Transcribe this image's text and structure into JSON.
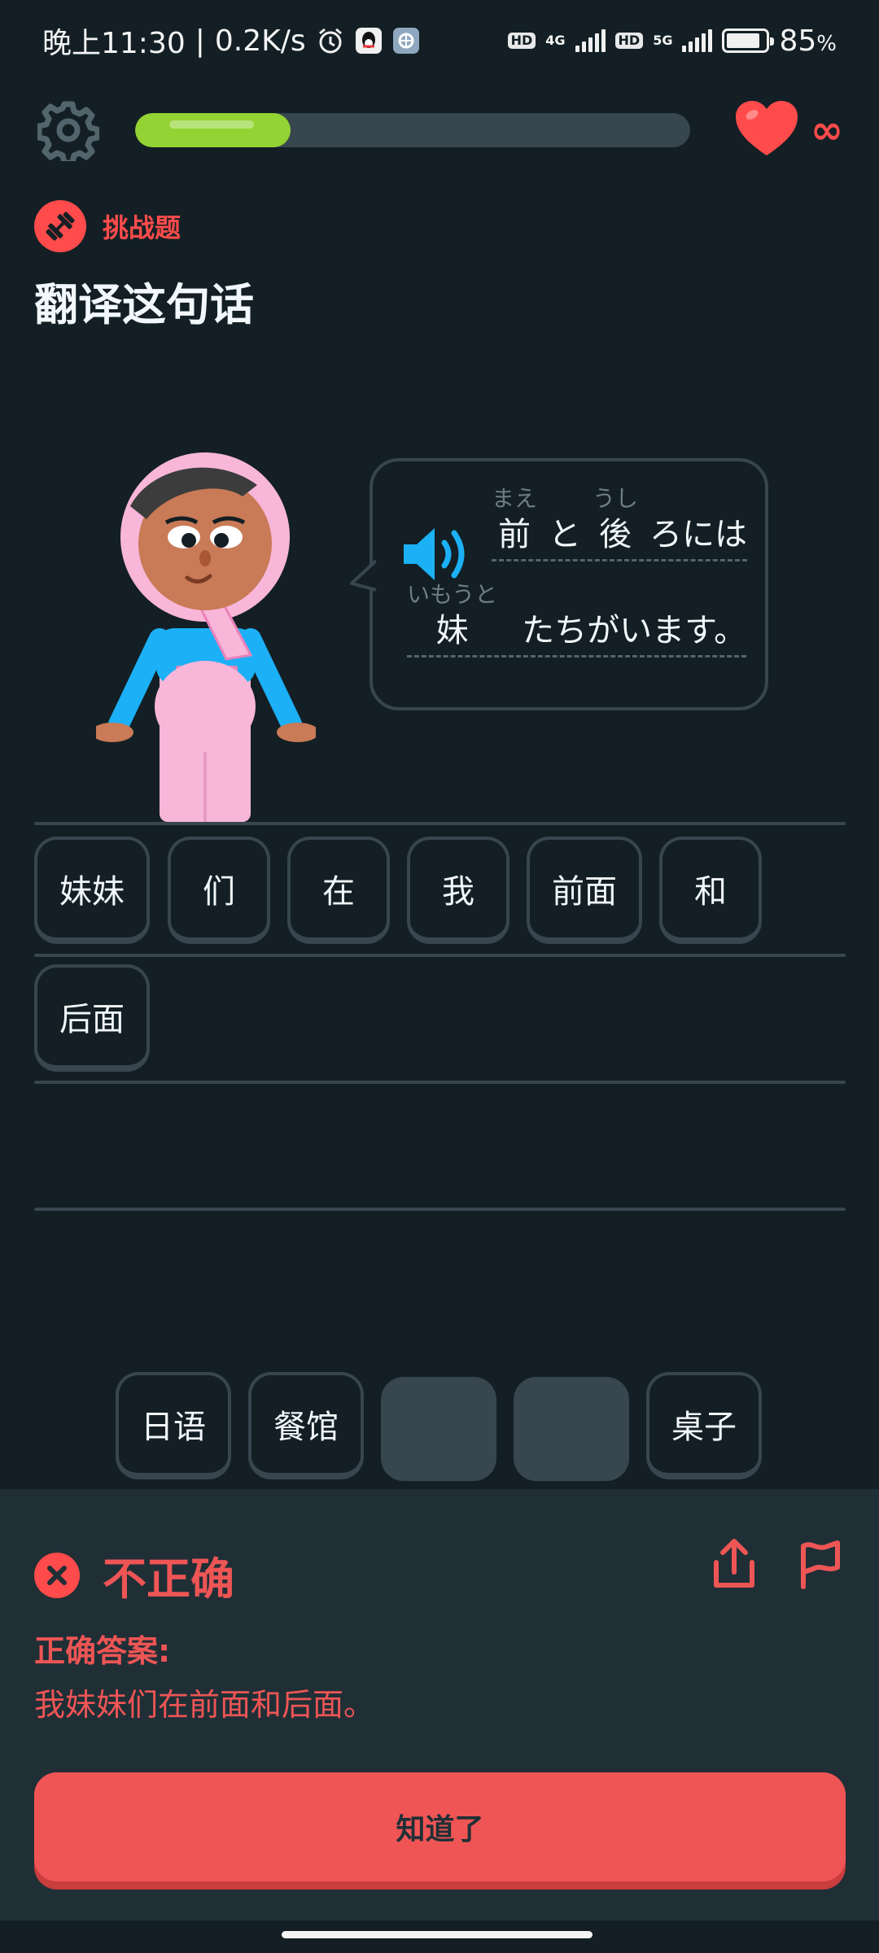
{
  "status_bar": {
    "time": "晚上11:30",
    "separator": "|",
    "net_speed": "0.2K/s",
    "hd_badge": "HD",
    "net1": "4G",
    "net2": "5G",
    "battery_percent": "85",
    "battery_unit": "%",
    "battery_level": 0.85,
    "icons": [
      "alarm-icon",
      "qq-icon",
      "vpn-icon",
      "hd-icon",
      "signal-icon",
      "battery-icon"
    ]
  },
  "top_bar": {
    "progress_fraction": 0.28,
    "hearts_value": "∞",
    "icons": [
      "gear-icon",
      "heart-icon"
    ]
  },
  "challenge": {
    "tag_label": "挑战题",
    "instruction": "翻译这句话"
  },
  "prompt": {
    "line1": [
      {
        "furigana": "まえ",
        "text": "前"
      },
      {
        "furigana": "",
        "text": "と"
      },
      {
        "furigana": "うし",
        "text": "後"
      },
      {
        "furigana": "",
        "text": "ろには"
      }
    ],
    "line2": [
      {
        "furigana": "いもうと",
        "text": "妹"
      },
      {
        "furigana": "",
        "text": "たちがいます。"
      }
    ]
  },
  "answer": {
    "row1": [
      "妹妹",
      "们",
      "在",
      "我",
      "前面",
      "和"
    ],
    "row2": [
      "后面"
    ]
  },
  "word_bank": [
    "日语",
    "餐馆",
    "",
    "",
    "桌子"
  ],
  "feedback": {
    "title": "不正确",
    "label": "正确答案:",
    "correct_answer": "我妹妹们在前面和后面。",
    "button_label": "知道了",
    "colors": {
      "error": "#ee5555",
      "button": "#f05555",
      "panel": "#202f36"
    }
  },
  "colors": {
    "background": "#131f24",
    "progress": "#93d333",
    "heart": "#ff4b4b",
    "speaker": "#1cb0f6"
  }
}
